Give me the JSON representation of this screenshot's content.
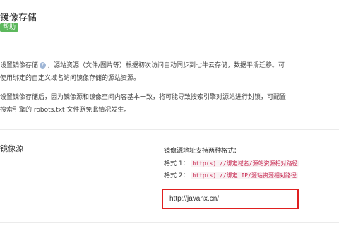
{
  "header": {
    "title": "镜像存储",
    "help_label": "帮助"
  },
  "description": {
    "line1_a": "设置镜像存储",
    "line1_b": "，源站资源（文件/图片等）根据初次访问自动同步到七牛云存储，数据平滑迁移。可",
    "line2": "使用绑定的自定义域名访问镜像存储的源站资源。",
    "line3": "设置镜像存储后，因为镜像源和镜像空间内容基本一致，将可能导致搜索引擎对源站进行封锁，可配置",
    "line4": "搜索引擎的 robots.txt 文件避免此情况发生。",
    "info_icon": "?"
  },
  "mirror_source": {
    "title": "镜像源",
    "formats_intro": "镜像源地址支持两种格式：",
    "format1_label": "格式 1：",
    "format1_code": "http(s)://绑定域名/源站资源相对路径",
    "format2_label": "格式 2：",
    "format2_code": "http(s)://绑定 IP/源站资源相对路径",
    "url_value": "http://javanx.cn/"
  },
  "colors": {
    "help_badge": "#5cb85c",
    "input_highlight": "#e02020",
    "code_text": "#c7254e"
  }
}
